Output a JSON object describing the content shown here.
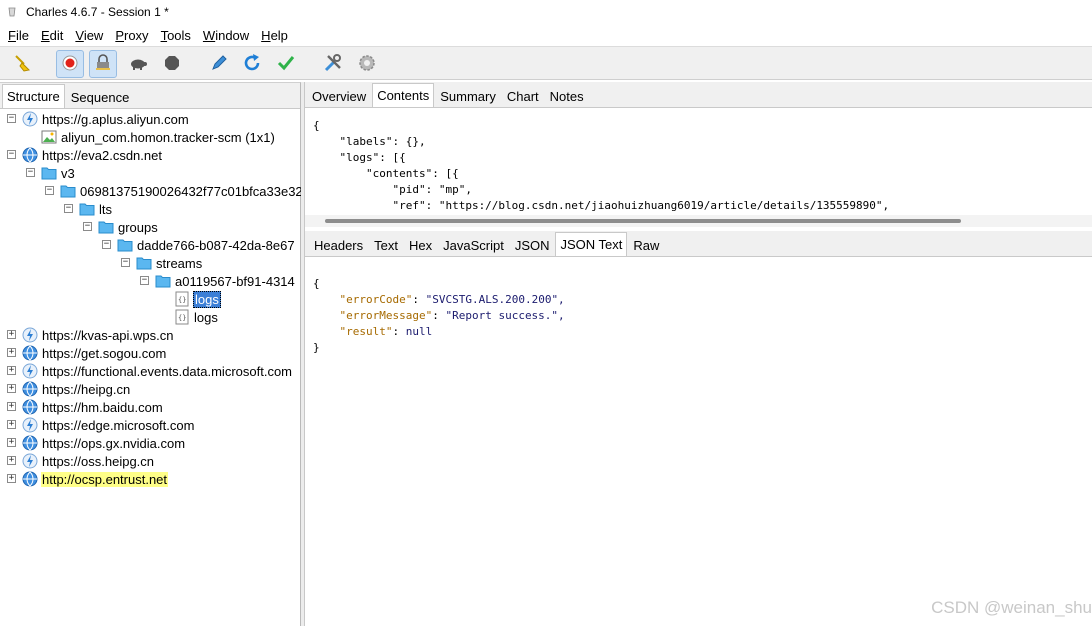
{
  "window": {
    "title": "Charles 4.6.7 - Session 1 *"
  },
  "menu": [
    {
      "pre": "",
      "u": "F",
      "post": "ile"
    },
    {
      "pre": "",
      "u": "E",
      "post": "dit"
    },
    {
      "pre": "",
      "u": "V",
      "post": "iew"
    },
    {
      "pre": "",
      "u": "P",
      "post": "roxy"
    },
    {
      "pre": "",
      "u": "T",
      "post": "ools"
    },
    {
      "pre": "",
      "u": "W",
      "post": "indow"
    },
    {
      "pre": "",
      "u": "H",
      "post": "elp"
    }
  ],
  "toolbar": [
    {
      "name": "broom-icon",
      "active": false
    },
    {
      "name": "record-icon",
      "active": true
    },
    {
      "name": "ssl-proxying-icon",
      "active": true
    },
    {
      "name": "throttle-turtle-icon",
      "active": false
    },
    {
      "name": "stop-breakpoints-icon",
      "active": false
    },
    {
      "name": "compose-pen-icon",
      "active": false
    },
    {
      "name": "repeat-icon",
      "active": false
    },
    {
      "name": "validate-check-icon",
      "active": false
    },
    {
      "name": "tools-icon",
      "active": false
    },
    {
      "name": "settings-gear-icon",
      "active": false
    }
  ],
  "left_tabs": [
    "Structure",
    "Sequence"
  ],
  "tree": [
    {
      "depth": 0,
      "expander": "⊟",
      "icon": "lightning",
      "label": "https://g.aplus.aliyun.com"
    },
    {
      "depth": 1,
      "expander": "",
      "icon": "image",
      "label": "aliyun_com.homon.tracker-scm (1x1)"
    },
    {
      "depth": 0,
      "expander": "⊟",
      "icon": "globe",
      "label": "https://eva2.csdn.net"
    },
    {
      "depth": 1,
      "expander": "⊟",
      "icon": "folder",
      "label": "v3"
    },
    {
      "depth": 2,
      "expander": "⊟",
      "icon": "folder",
      "label": "06981375190026432f77c01bfca33e32"
    },
    {
      "depth": 3,
      "expander": "⊟",
      "icon": "folder",
      "label": "lts"
    },
    {
      "depth": 4,
      "expander": "⊟",
      "icon": "folder",
      "label": "groups"
    },
    {
      "depth": 5,
      "expander": "⊟",
      "icon": "folder",
      "label": "dadde766-b087-42da-8e67"
    },
    {
      "depth": 6,
      "expander": "⊟",
      "icon": "folder",
      "label": "streams"
    },
    {
      "depth": 7,
      "expander": "⊟",
      "icon": "folder",
      "label": "a0119567-bf91-4314"
    },
    {
      "depth": 8,
      "expander": "",
      "icon": "json",
      "label": "logs",
      "selected": true
    },
    {
      "depth": 8,
      "expander": "",
      "icon": "json",
      "label": "logs"
    },
    {
      "depth": 0,
      "expander": "⊞",
      "icon": "lightning",
      "label": "https://kvas-api.wps.cn"
    },
    {
      "depth": 0,
      "expander": "⊞",
      "icon": "globe",
      "label": "https://get.sogou.com"
    },
    {
      "depth": 0,
      "expander": "⊞",
      "icon": "lightning",
      "label": "https://functional.events.data.microsoft.com"
    },
    {
      "depth": 0,
      "expander": "⊞",
      "icon": "globe",
      "label": "https://heipg.cn"
    },
    {
      "depth": 0,
      "expander": "⊞",
      "icon": "globe",
      "label": "https://hm.baidu.com"
    },
    {
      "depth": 0,
      "expander": "⊞",
      "icon": "lightning",
      "label": "https://edge.microsoft.com"
    },
    {
      "depth": 0,
      "expander": "⊞",
      "icon": "globe",
      "label": "https://ops.gx.nvidia.com"
    },
    {
      "depth": 0,
      "expander": "⊞",
      "icon": "lightning",
      "label": "https://oss.heipg.cn"
    },
    {
      "depth": 0,
      "expander": "⊞",
      "icon": "globe",
      "label": "http://ocsp.entrust.net",
      "highlight": true
    }
  ],
  "top_tabs": [
    "Overview",
    "Contents",
    "Summary",
    "Chart",
    "Notes"
  ],
  "top_tab_selected": "Contents",
  "request_body_lines": [
    "{",
    "    \"labels\": {},",
    "    \"logs\": [{",
    "        \"contents\": [{",
    "            \"pid\": \"mp\",",
    "            \"ref\": \"https://blog.csdn.net/jiaohuizhuang6019/article/details/135559890\","
  ],
  "response_tabs": [
    "Headers",
    "Text",
    "Hex",
    "JavaScript",
    "JSON",
    "JSON Text",
    "Raw"
  ],
  "response_tab_selected": "JSON Text",
  "response_lines": [
    {
      "indent": "",
      "key": "",
      "sep": "",
      "value": "{"
    },
    {
      "indent": "    ",
      "key": "\"errorCode\"",
      "sep": ": ",
      "value": "\"SVCSTG.ALS.200.200\","
    },
    {
      "indent": "    ",
      "key": "\"errorMessage\"",
      "sep": ": ",
      "value": "\"Report success.\","
    },
    {
      "indent": "    ",
      "key": "\"result\"",
      "sep": ": ",
      "value": "null"
    },
    {
      "indent": "",
      "key": "",
      "sep": "",
      "value": "}"
    }
  ],
  "watermark": "CSDN @weinan_shu",
  "colors": {
    "selection": "#3c7fd6",
    "highlight": "#ffff88",
    "toolbar_active": "#cfe3f7",
    "folder": "#5bb7f0",
    "json_key": "#a66a00"
  }
}
